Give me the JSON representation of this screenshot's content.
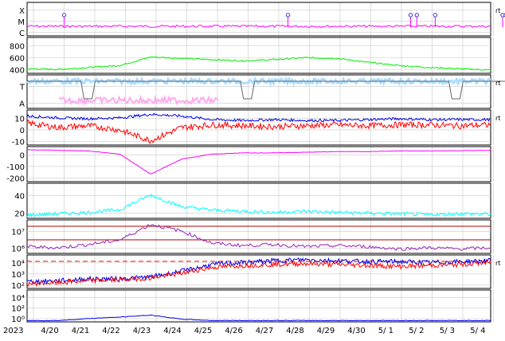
{
  "colors": {
    "magenta": "#ff00ff",
    "green": "#00ee00",
    "lightblue": "#aaddff",
    "pink": "#ffaaee",
    "blue": "#0000ee",
    "red": "#ff0000",
    "cyan": "#00ffff",
    "purple": "#9922bb",
    "darkred": "#aa0000",
    "grid": "#c8c8c8",
    "gray": "#666666"
  },
  "chart_data": {
    "type": "line",
    "x_labels": [
      "2023",
      "4/20",
      "4/21",
      "4/22",
      "4/23",
      "4/24",
      "4/25",
      "4/26",
      "4/27",
      "4/28",
      "4/29",
      "4/30",
      "5/ 1",
      "5/ 2",
      "5/ 3",
      "5/ 4"
    ],
    "right_tag": "rt",
    "panels": [
      {
        "id": "xray",
        "yticks": [
          "X",
          "M",
          "C"
        ],
        "series": [
          {
            "color": "magenta",
            "baseline_class": "C",
            "flare_days": [
              1.0,
              8.3,
              12.3,
              12.5,
              13.1,
              15.3,
              15.4,
              15.5,
              16.3
            ]
          }
        ]
      },
      {
        "id": "solar-wind-speed",
        "yticks": [
          "800",
          "600",
          "400"
        ],
        "ylim": [
          350,
          900
        ],
        "series": [
          {
            "color": "green",
            "values": [
              420,
              410,
              440,
              470,
              600,
              580,
              560,
              540,
              560,
              590,
              580,
              520,
              470,
              440,
              420,
              400
            ]
          }
        ]
      },
      {
        "id": "bz-orientation",
        "yticks": [
          "T",
          "A"
        ],
        "series": [
          {
            "color": "lightblue"
          },
          {
            "color": "pink"
          },
          {
            "color": "gray",
            "dips_days": [
              1.7,
              6.9,
              13.7,
              15.6
            ]
          }
        ]
      },
      {
        "id": "magnetic-field",
        "yticks": [
          "10",
          "0",
          "-10"
        ],
        "ylim": [
          -25,
          15
        ],
        "series": [
          {
            "color": "blue",
            "values": [
              8,
              6,
              5,
              6,
              10,
              8,
              4,
              3,
              4,
              3,
              3,
              4,
              5,
              4,
              4,
              4
            ]
          },
          {
            "color": "red",
            "values": [
              0,
              -5,
              -3,
              -8,
              -20,
              -5,
              -2,
              -3,
              -4,
              -3,
              -2,
              -3,
              -2,
              -2,
              -3,
              -2
            ]
          }
        ]
      },
      {
        "id": "dst",
        "yticks": [
          "0",
          "-100",
          "-200"
        ],
        "ylim": [
          -260,
          20
        ],
        "series": [
          {
            "color": "magenta",
            "values": [
              -5,
              -10,
              -15,
              -40,
              -200,
              -80,
              -40,
              -30,
              -30,
              -25,
              -20,
              -20,
              -15,
              -15,
              -12,
              -10
            ]
          }
        ]
      },
      {
        "id": "density",
        "yticks": [
          "40",
          "20"
        ],
        "ylim": [
          0,
          60
        ],
        "series": [
          {
            "color": "cyan",
            "values": [
              5,
              8,
              10,
              15,
              40,
              20,
              14,
              12,
              10,
              12,
              10,
              9,
              8,
              6,
              8,
              7
            ]
          }
        ]
      },
      {
        "id": "temperature",
        "yticks": [
          "10⁷",
          "10⁶"
        ],
        "series": [
          {
            "color": "purple",
            "values": [
              5.2,
              5.1,
              5.4,
              5.8,
              7.2,
              6.6,
              5.5,
              5.3,
              5.4,
              5.2,
              5.3,
              5.2,
              5.0,
              5.1,
              5.0,
              5.1
            ]
          }
        ]
      },
      {
        "id": "electron-flux",
        "yticks": [
          "10⁴",
          "10³",
          "10²"
        ],
        "series": [
          {
            "color": "blue",
            "values": [
              1.7,
              1.8,
              2.0,
              2.0,
              2.2,
              2.8,
              3.5,
              3.7,
              3.9,
              4.0,
              3.9,
              3.8,
              3.8,
              3.7,
              3.8,
              3.9
            ]
          },
          {
            "color": "red",
            "values": [
              1.5,
              1.6,
              1.8,
              1.9,
              2.1,
              2.6,
              3.2,
              3.4,
              3.5,
              3.6,
              3.5,
              3.4,
              3.3,
              3.4,
              3.5,
              3.7
            ]
          }
        ]
      },
      {
        "id": "proton-flux",
        "yticks": [
          "10⁴",
          "10²",
          "10⁰"
        ],
        "series": [
          {
            "color": "blue",
            "values": [
              0.0,
              0.0,
              0.3,
              0.5,
              0.8,
              0.2,
              0.0,
              0.0,
              0.0,
              0.0,
              0.0,
              0.0,
              0.0,
              0.0,
              0.0,
              0.0
            ]
          }
        ]
      }
    ]
  }
}
